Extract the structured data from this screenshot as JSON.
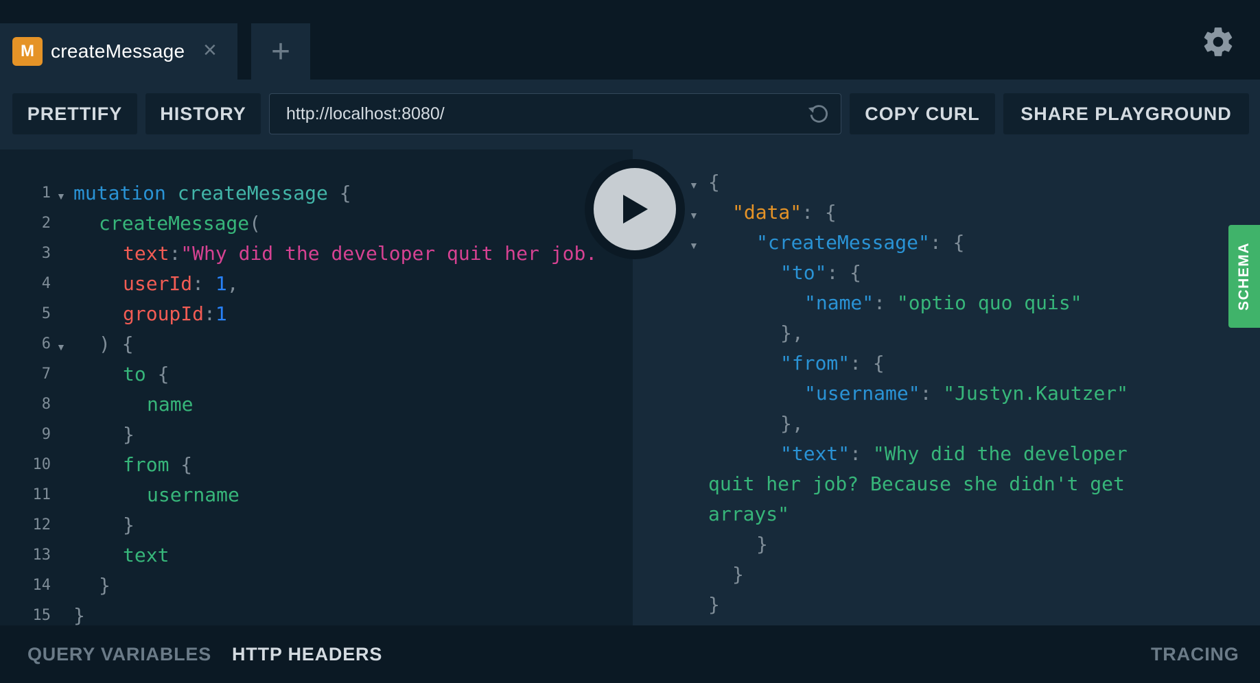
{
  "tabs": [
    {
      "badge": "M",
      "title": "createMessage",
      "close": "×"
    }
  ],
  "new_tab_icon": "+",
  "toolbar": {
    "prettify": "PRETTIFY",
    "history": "HISTORY",
    "endpoint": "http://localhost:8080/",
    "copy_curl": "COPY CURL",
    "share": "SHARE PLAYGROUND"
  },
  "query_lines": [
    "1",
    "2",
    "3",
    "4",
    "5",
    "6",
    "7",
    "8",
    "9",
    "10",
    "11",
    "12",
    "13",
    "14",
    "15"
  ],
  "query": {
    "l1_kw": "mutation",
    "l1_name": "createMessage",
    "l1_brace": "{",
    "l2_fn": "createMessage",
    "l2_paren": "(",
    "l3_arg": "text",
    "l3_colon": ":",
    "l3_str": "\"Why did the developer quit her job.",
    "l4_arg": "userId",
    "l4_colon": ":",
    "l4_num": "1",
    "l4_comma": ",",
    "l5_arg": "groupId",
    "l5_colon": ":",
    "l5_num": "1",
    "l6": ") {",
    "l7_field": "to",
    "l7_brace": "{",
    "l8_field": "name",
    "l9": "}",
    "l10_field": "from",
    "l10_brace": "{",
    "l11_field": "username",
    "l12": "}",
    "l13_field": "text",
    "l14": "}",
    "l15": "}"
  },
  "result": {
    "r1": "{",
    "data_key": "\"data\"",
    "data_rest": ": {",
    "cm_key": "\"createMessage\"",
    "cm_rest": ": {",
    "to_key": "\"to\"",
    "to_rest": ": {",
    "name_key": "\"name\"",
    "name_colon": ": ",
    "name_val": "\"optio quo quis\"",
    "close_to": "},",
    "from_key": "\"from\"",
    "from_rest": ": {",
    "username_key": "\"username\"",
    "username_colon": ": ",
    "username_val": "\"Justyn.Kautzer\"",
    "close_from": "},",
    "text_key": "\"text\"",
    "text_colon": ": ",
    "text_val_1": "\"Why did the developer",
    "text_val_2": "quit her job? Because she didn't get",
    "text_val_3": "arrays\"",
    "close_cm": "}",
    "close_data": "}",
    "close_root": "}"
  },
  "schema_tab": "SCHEMA",
  "bottom": {
    "query_variables": "QUERY VARIABLES",
    "http_headers": "HTTP HEADERS",
    "tracing": "TRACING"
  },
  "colors": {
    "background": "#0f202d",
    "panel": "#172a3a",
    "accent_badge": "#e59327",
    "schema_green": "#40b36a"
  },
  "icons": [
    "gear-icon",
    "close-icon",
    "plus-icon",
    "reload-icon",
    "play-icon",
    "fold-arrow-icon"
  ]
}
